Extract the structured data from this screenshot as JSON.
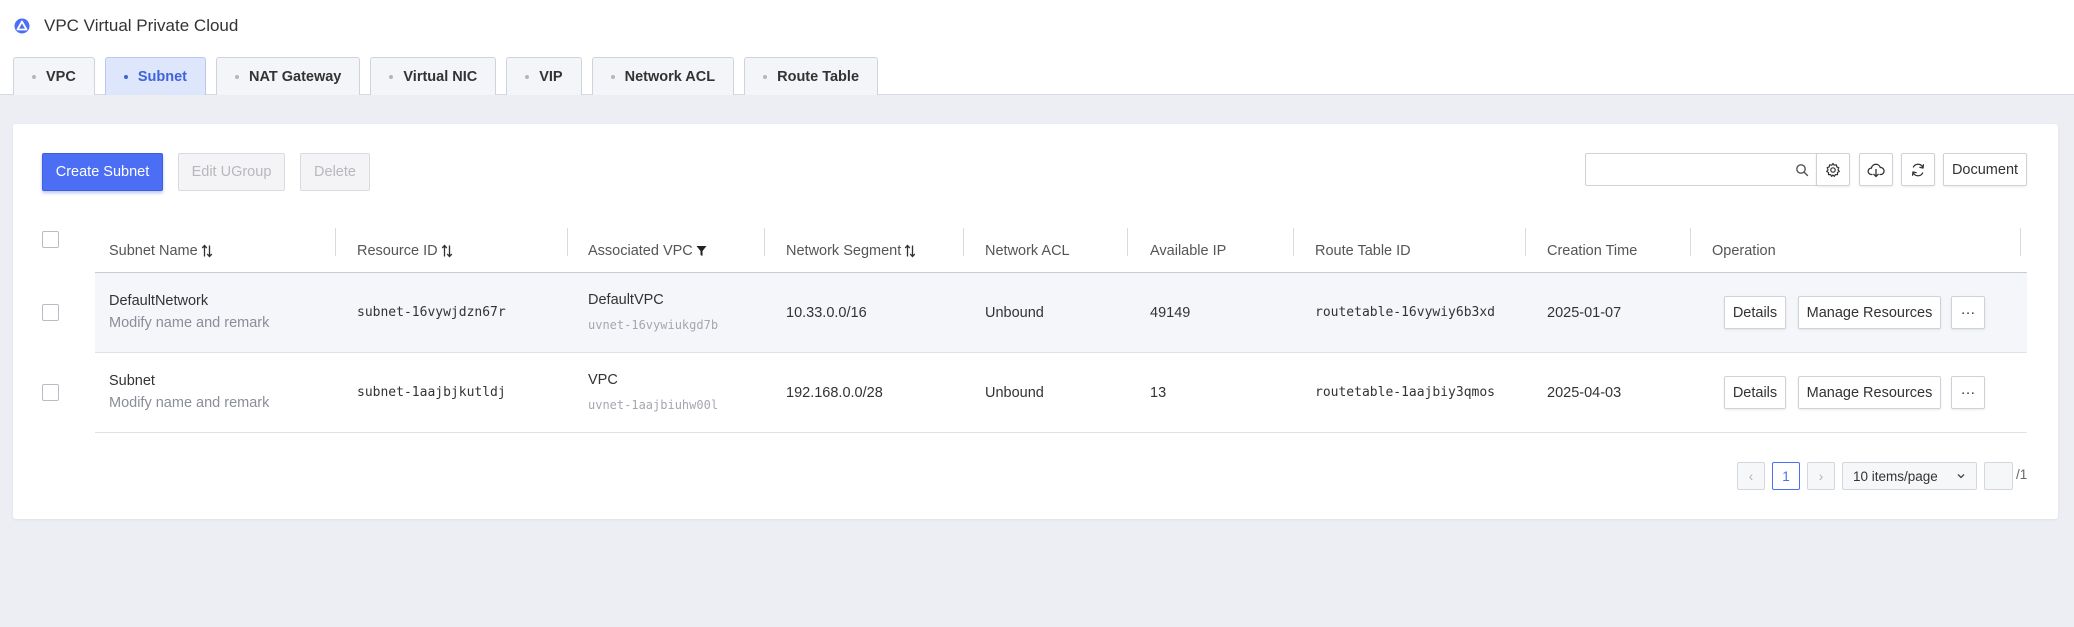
{
  "app": {
    "title": "VPC Virtual Private Cloud",
    "logo_icon": "cloud-triangle-icon",
    "accent_color": "#4c6ef5"
  },
  "tabs": [
    {
      "label": "VPC",
      "active": false
    },
    {
      "label": "Subnet",
      "active": true
    },
    {
      "label": "NAT Gateway",
      "active": false
    },
    {
      "label": "Virtual NIC",
      "active": false
    },
    {
      "label": "VIP",
      "active": false
    },
    {
      "label": "Network ACL",
      "active": false
    },
    {
      "label": "Route Table",
      "active": false
    }
  ],
  "toolbar": {
    "create_label": "Create Subnet",
    "edit_label": "Edit UGroup",
    "delete_label": "Delete",
    "search_placeholder": "",
    "document_label": "Document"
  },
  "table": {
    "columns": [
      {
        "label": "Subnet Name",
        "icon": "sort-icon"
      },
      {
        "label": "Resource ID",
        "icon": "sort-icon"
      },
      {
        "label": "Associated VPC",
        "icon": "filter-icon"
      },
      {
        "label": "Network Segment",
        "icon": "sort-icon"
      },
      {
        "label": "Network ACL",
        "icon": ""
      },
      {
        "label": "Available IP",
        "icon": ""
      },
      {
        "label": "Route Table ID",
        "icon": ""
      },
      {
        "label": "Creation Time",
        "icon": ""
      },
      {
        "label": "Operation",
        "icon": ""
      }
    ],
    "rows": [
      {
        "name": "DefaultNetwork",
        "remark": "Modify name and remark",
        "resource_id": "subnet-16vywjdzn67r",
        "vpc_name": "DefaultVPC",
        "vpc_id": "uvnet-16vywiukgd7b",
        "segment": "10.33.0.0/16",
        "acl": "Unbound",
        "available_ip": "49149",
        "route_table_id": "routetable-16vywiy6b3xd",
        "created": "2025-01-07",
        "details_label": "Details",
        "manage_label": "Manage Resources",
        "more_label": "···"
      },
      {
        "name": "Subnet",
        "remark": "Modify name and remark",
        "resource_id": "subnet-1aajbjkutldj",
        "vpc_name": "VPC",
        "vpc_id": "uvnet-1aajbiuhw00l",
        "segment": "192.168.0.0/28",
        "acl": "Unbound",
        "available_ip": "13",
        "route_table_id": "routetable-1aajbiy3qmos",
        "created": "2025-04-03",
        "details_label": "Details",
        "manage_label": "Manage Resources",
        "more_label": "···"
      }
    ]
  },
  "pagination": {
    "prev": "‹",
    "current_page": "1",
    "next": "›",
    "page_size": "10 items/page",
    "jump_value": "",
    "total_pages": "/1"
  }
}
